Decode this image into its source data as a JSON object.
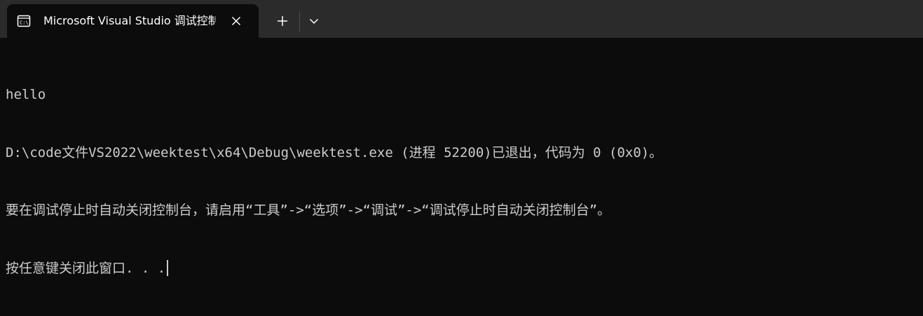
{
  "window": {
    "tab_title": "Microsoft Visual Studio 调试控制台",
    "tab_icon": "console-icon",
    "close_icon": "close-icon",
    "new_tab_icon": "plus-icon",
    "dropdown_icon": "chevron-down-icon"
  },
  "console": {
    "lines": [
      "hello",
      "D:\\code文件VS2022\\weektest\\x64\\Debug\\weektest.exe (进程 52200)已退出，代码为 0 (0x0)。",
      "要在调试停止时自动关闭控制台，请启用“工具”->“选项”->“调试”->“调试停止时自动关闭控制台”。",
      "按任意键关闭此窗口. . ."
    ]
  },
  "colors": {
    "titlebar_bg": "#2b2b2b",
    "tab_bg": "#0c0c0c",
    "console_bg": "#0c0c0c",
    "console_text": "#cccccc",
    "tab_text": "#ffffff"
  }
}
